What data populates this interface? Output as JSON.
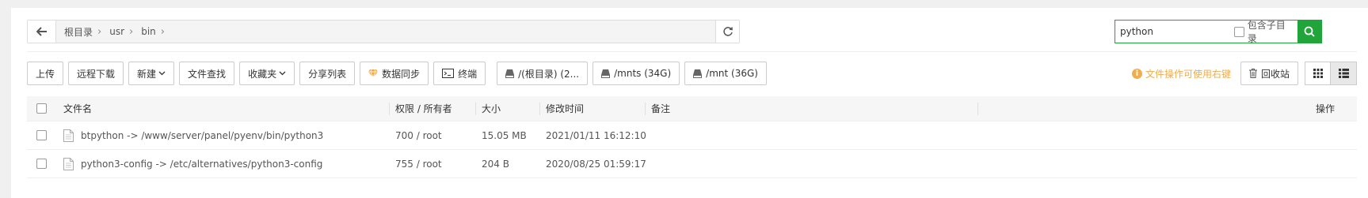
{
  "pathbar": {
    "crumbs": [
      "根目录",
      "usr",
      "bin"
    ]
  },
  "search": {
    "value": "python",
    "include_sub_label": "包含子目录"
  },
  "toolbar": {
    "upload": "上传",
    "remote_download": "远程下载",
    "new": "新建",
    "file_search": "文件查找",
    "favorites": "收藏夹",
    "share_list": "分享列表",
    "data_sync": "数据同步",
    "terminal": "终端",
    "disks": [
      "/(根目录) (2...",
      "/mnts (34G)",
      "/mnt (36G)"
    ],
    "hint": "文件操作可使用右键",
    "recycle_bin": "回收站"
  },
  "table": {
    "headers": {
      "name": "文件名",
      "perm": "权限 / 所有者",
      "size": "大小",
      "mtime": "修改时间",
      "note": "备注",
      "op": "操作"
    },
    "rows": [
      {
        "name": "btpython -> /www/server/panel/pyenv/bin/python3",
        "perm": "700 / root",
        "size": "15.05 MB",
        "mtime": "2021/01/11 16:12:10"
      },
      {
        "name": "python3-config -> /etc/alternatives/python3-config",
        "perm": "755 / root",
        "size": "204 B",
        "mtime": "2020/08/25 01:59:17"
      }
    ]
  },
  "colors": {
    "accent": "#20a53a",
    "warning": "#f0ad4e"
  }
}
